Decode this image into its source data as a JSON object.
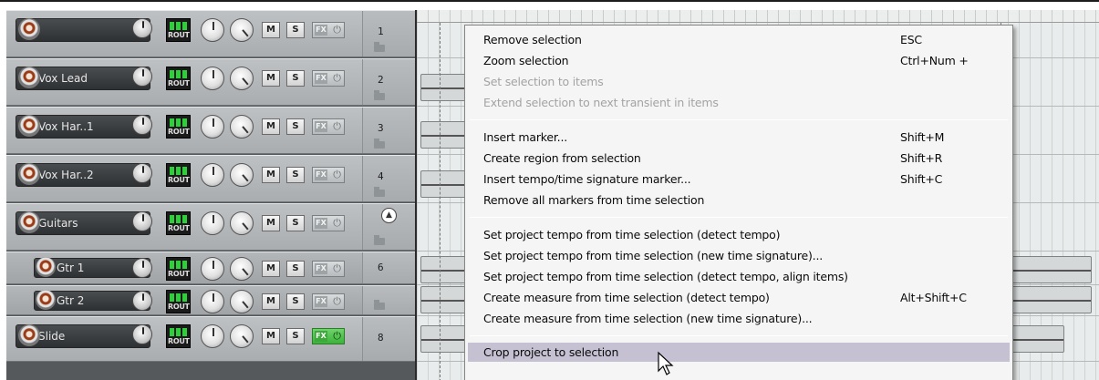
{
  "tracks": [
    {
      "name": "",
      "number": "1",
      "rout": "ROUT",
      "mute": "M",
      "solo": "S",
      "fx": "FX",
      "power": "⏻"
    },
    {
      "name": "Vox Lead",
      "number": "2",
      "rout": "ROUT",
      "mute": "M",
      "solo": "S",
      "fx": "FX",
      "power": "⏻"
    },
    {
      "name": "Vox Har..1",
      "number": "3",
      "rout": "ROUT",
      "mute": "M",
      "solo": "S",
      "fx": "FX",
      "power": "⏻"
    },
    {
      "name": "Vox Har..2",
      "number": "4",
      "rout": "ROUT",
      "mute": "M",
      "solo": "S",
      "fx": "FX",
      "power": "⏻"
    },
    {
      "name": "Guitars",
      "number": "",
      "rout": "ROUT",
      "mute": "M",
      "solo": "S",
      "fx": "FX",
      "power": "⏻"
    },
    {
      "name": "Gtr 1",
      "number": "6",
      "rout": "ROUT",
      "mute": "M",
      "solo": "S",
      "fx": "FX",
      "power": "⏻"
    },
    {
      "name": "Gtr 2",
      "number": "",
      "rout": "ROUT",
      "mute": "M",
      "solo": "S",
      "fx": "FX",
      "power": "⏻"
    },
    {
      "name": "Slide",
      "number": "8",
      "rout": "ROUT",
      "mute": "M",
      "solo": "S",
      "fx": "FX",
      "power": "⏻"
    }
  ],
  "menu": {
    "items": [
      {
        "label": "Remove selection",
        "shortcut": "ESC"
      },
      {
        "label": "Zoom selection",
        "shortcut": "Ctrl+Num +"
      },
      {
        "label": "Set selection to items",
        "shortcut": ""
      },
      {
        "label": "Extend selection to next transient in items",
        "shortcut": ""
      },
      {
        "label": "Insert marker...",
        "shortcut": "Shift+M"
      },
      {
        "label": "Create region from selection",
        "shortcut": "Shift+R"
      },
      {
        "label": "Insert tempo/time signature marker...",
        "shortcut": "Shift+C"
      },
      {
        "label": "Remove all markers from time selection",
        "shortcut": ""
      },
      {
        "label": "Set project tempo from time selection (detect tempo)",
        "shortcut": ""
      },
      {
        "label": "Set project tempo from time selection (new time signature)...",
        "shortcut": ""
      },
      {
        "label": "Set project tempo from time selection (detect tempo, align items)",
        "shortcut": ""
      },
      {
        "label": "Create measure from time selection (detect tempo)",
        "shortcut": "Alt+Shift+C"
      },
      {
        "label": "Create measure from time selection (new time signature)...",
        "shortcut": ""
      },
      {
        "label": "Crop project to selection",
        "shortcut": ""
      }
    ]
  },
  "colors": {
    "menu_highlight": "#c5c1d2",
    "fx_active": "#3bb23a",
    "panel_gray": "#a9adb0"
  }
}
